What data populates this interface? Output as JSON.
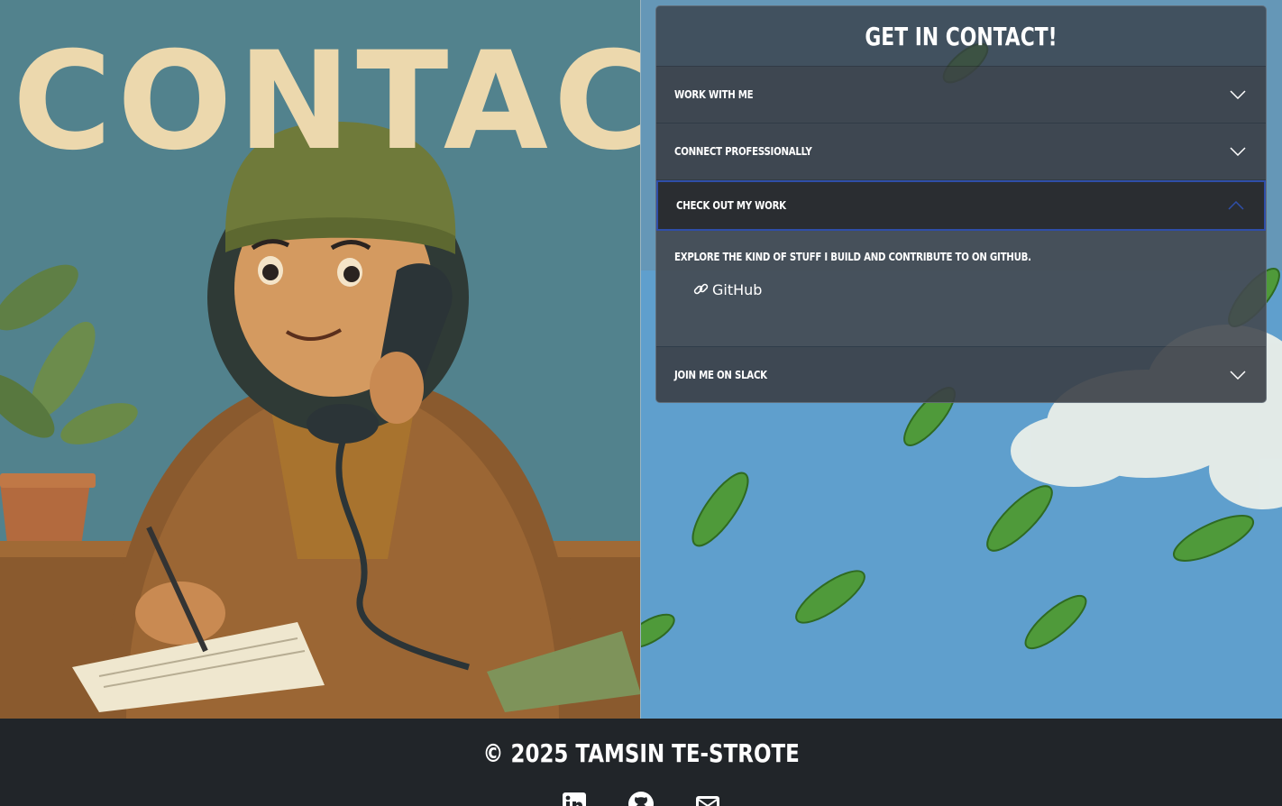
{
  "hero": {
    "word": "CONTACT"
  },
  "panel": {
    "title": "GET IN CONTACT!",
    "items": [
      {
        "label": "WORK WITH ME",
        "expanded": false
      },
      {
        "label": "CONNECT PROFESSIONALLY",
        "expanded": false
      },
      {
        "label": "CHECK OUT MY WORK",
        "expanded": true,
        "description": "EXPLORE THE KIND OF STUFF I BUILD AND CONTRIBUTE TO ON GITHUB.",
        "link_label": "GitHub",
        "link_icon": "link-icon"
      },
      {
        "label": "JOIN ME ON SLACK",
        "expanded": false
      }
    ]
  },
  "footer": {
    "copyright": "© 2025 TAMSIN TE-STROTE",
    "icons": [
      "linkedin-icon",
      "github-icon",
      "envelope-icon"
    ]
  },
  "colors": {
    "footer_bg": "#212529",
    "panel_bg": "#3a4048",
    "active_border": "#2f4ea8",
    "title_text": "#ecd8ad"
  }
}
